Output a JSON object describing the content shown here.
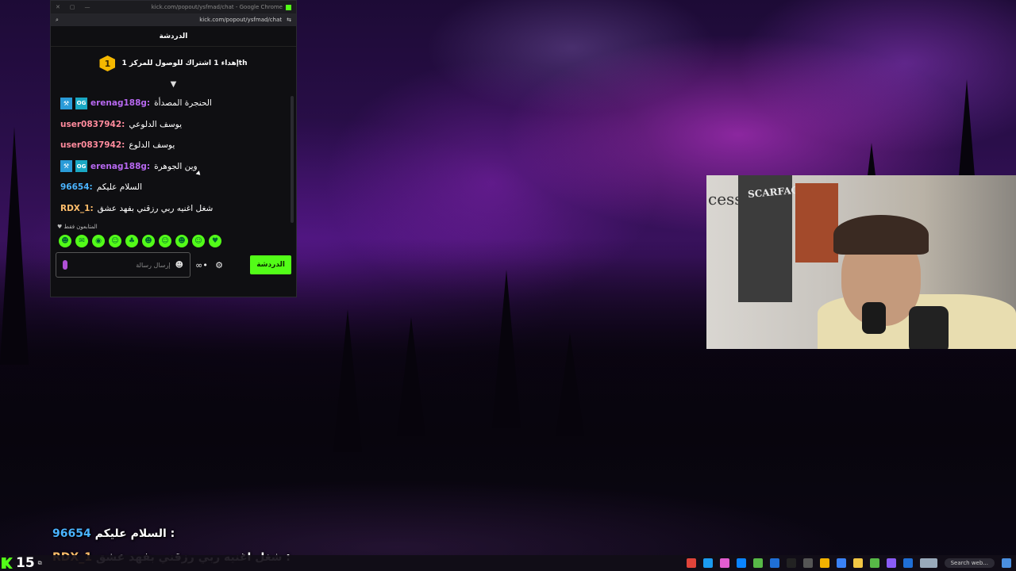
{
  "browser": {
    "title": "kick.com/popout/ysfmad/chat - Google Chrome",
    "url": "kick.com/popout/ysfmad/chat"
  },
  "chat": {
    "header": "الدردشة",
    "sub_goal_number": "1",
    "sub_goal_text": "إهداء 1 اشتراك للوصول للمركز 1th",
    "messages": [
      {
        "user": "erenag188g:",
        "user_color": "#b768f0",
        "badges": true,
        "text": "الحنجرة المصدأة"
      },
      {
        "user": "user0837942:",
        "user_color": "#ff8b9d",
        "badges": false,
        "text": "يوسف الدلوعي"
      },
      {
        "user": "user0837942:",
        "user_color": "#ff8b9d",
        "badges": false,
        "text": "يوسف الدلوع"
      },
      {
        "user": "erenag188g:",
        "user_color": "#b768f0",
        "badges": true,
        "text": "وين الجوهرة"
      },
      {
        "user": "96654:",
        "user_color": "#4ab3ff",
        "badges": false,
        "text": "السلام عليكم"
      },
      {
        "user": "RDX_1:",
        "user_color": "#ffbe6b",
        "badges": false,
        "text": "شغل اغنيه ربي رزقني بفهد عشق"
      }
    ],
    "followers_only": "المتابعون فقط",
    "input_placeholder": "إرسال رسالة",
    "send_label": "الدردشة"
  },
  "overlay": [
    {
      "user": "96654",
      "user_color": "#4ab3ff",
      "text": "السلام عليكم :"
    },
    {
      "user": "RDX_1",
      "user_color": "#ffbe6b",
      "text": "شغل اغنيه ربي رزقني بفهد عشق :"
    }
  ],
  "taskbar": {
    "counter": "15",
    "search": "Search web..."
  },
  "webcam": {
    "poster_text": "SCARFACE",
    "wall_text": "cess"
  }
}
